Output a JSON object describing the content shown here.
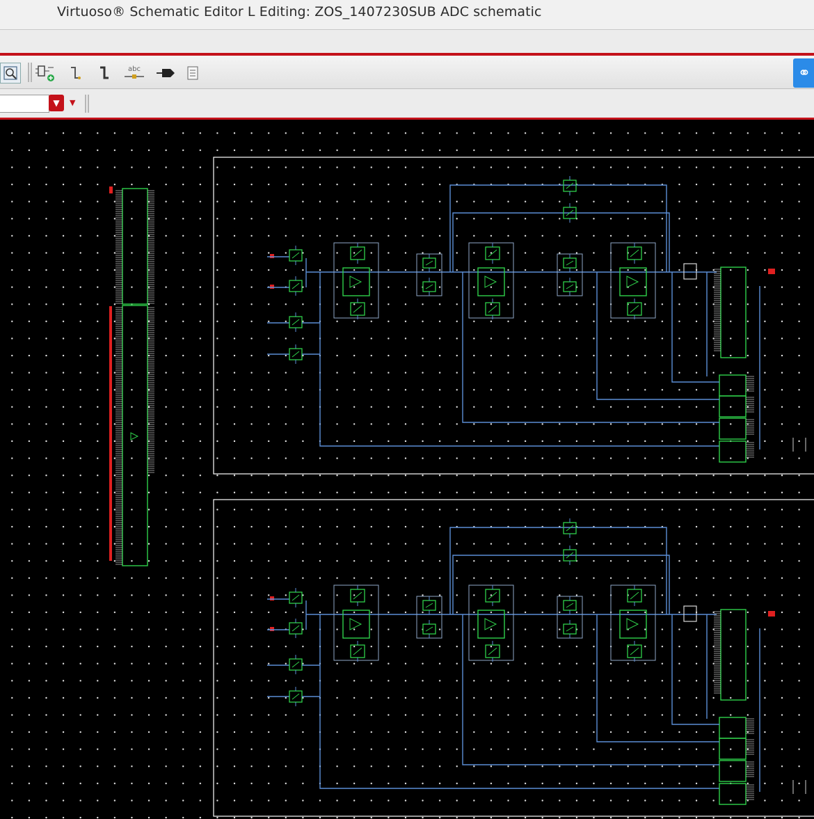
{
  "window": {
    "title": "Virtuoso® Schematic Editor L Editing: ZOS_1407230SUB ADC schematic"
  },
  "toolbar": {
    "icons": [
      "zoom-fit-icon",
      "add-instance-icon",
      "add-wire-icon",
      "add-wide-wire-icon",
      "add-label-icon",
      "add-pin-icon",
      "properties-icon"
    ],
    "label_icon_text": "abc",
    "combo_value": "",
    "right_button_icon": "link-icon"
  },
  "colors": {
    "accent": "#c4121a",
    "wire": "#5b8ed6",
    "device": "#2fd04a",
    "pin": "#e02020",
    "border": "#ffffff",
    "grid_dot": "#e8e8e8"
  }
}
